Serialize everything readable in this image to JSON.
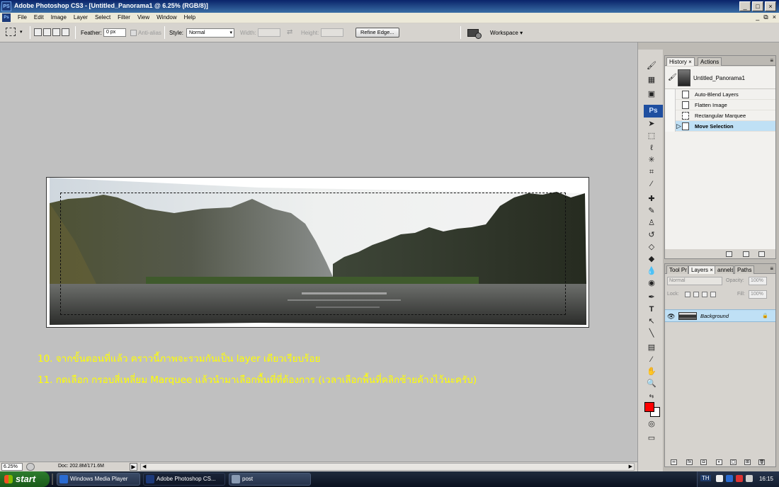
{
  "window": {
    "app_icon": "PS",
    "title": "Adobe Photoshop CS3 - [Untitled_Panorama1 @ 6.25% (RGB/8)]",
    "controls": [
      "_",
      "□",
      "×"
    ]
  },
  "menubar": {
    "items": [
      "File",
      "Edit",
      "Image",
      "Layer",
      "Select",
      "Filter",
      "View",
      "Window",
      "Help"
    ],
    "doc_controls": [
      "_",
      "⧉",
      "×"
    ]
  },
  "options_bar": {
    "feather_label": "Feather:",
    "feather_value": "0 px",
    "antialias_label": "Anti-alias",
    "style_label": "Style:",
    "style_value": "Normal",
    "width_label": "Width:",
    "height_label": "Height:",
    "refine_edge": "Refine Edge...",
    "workspace": "Workspace ▾"
  },
  "captions": [
    "10. จากขั้นตอนที่แล้ว คราวนี้ภาพจะรวมกันเป็น layer เดียวเรียบร้อย",
    "11. กดเลือก กรอบสี่เหลี่ยม Marquee แล้วนำมาเลือกพื้นที่ที่ต้องการ (เวลาเลือกพื้นที่คลิกซ้ายค้างไว้นะครับ)"
  ],
  "caption_color": "#ffff00",
  "status_bar": {
    "zoom": "6.25%",
    "doc_info": "Doc: 202.8M/171.6M",
    "arrow": "▶"
  },
  "tools": {
    "ps_label": "Ps",
    "foreground_color": "#ff0000",
    "background_color": "#ffffff",
    "icons": [
      "brush-panel-icon",
      "layer-comp-icon",
      "tool-presets-icon",
      "move-tool-icon",
      "rectangular-marquee-tool-icon",
      "lasso-tool-icon",
      "magic-wand-tool-icon",
      "crop-tool-icon",
      "eyedropper-tool-icon",
      "healing-brush-tool-icon",
      "brush-tool-icon",
      "clone-stamp-tool-icon",
      "history-brush-tool-icon",
      "eraser-tool-icon",
      "paint-bucket-tool-icon",
      "blur-tool-icon",
      "dodge-tool-icon",
      "pen-tool-icon",
      "type-tool-icon",
      "path-selection-tool-icon",
      "line-tool-icon",
      "notes-tool-icon",
      "eyedropper-2-icon",
      "hand-tool-icon",
      "zoom-tool-icon",
      "quick-mask-icon",
      "screen-mode-icon"
    ]
  },
  "history_panel": {
    "tabs": [
      "History",
      "Actions"
    ],
    "snapshot": "Untitled_Panorama1",
    "items": [
      "Auto-Blend Layers",
      "Flatten Image",
      "Rectangular Marquee",
      "Move Selection"
    ],
    "active_index": 3
  },
  "layers_panel": {
    "tabs": [
      "Tool Pr",
      "Layers",
      "annels",
      "Paths"
    ],
    "blend_mode": "Normal",
    "opacity_label": "Opacity:",
    "opacity_value": "100%",
    "lock_label": "Lock:",
    "fill_label": "Fill:",
    "fill_value": "100%",
    "layer_name": "Background",
    "foot_icons": [
      "∞",
      "fx",
      "◘",
      "◐",
      "▢",
      "⊞",
      "🗑"
    ]
  },
  "taskbar": {
    "start": "start",
    "tasks": [
      "Windows Media Player",
      "Adobe Photoshop CS...",
      "post"
    ],
    "active_task_index": 1,
    "lang": "TH",
    "time": "16:15"
  }
}
